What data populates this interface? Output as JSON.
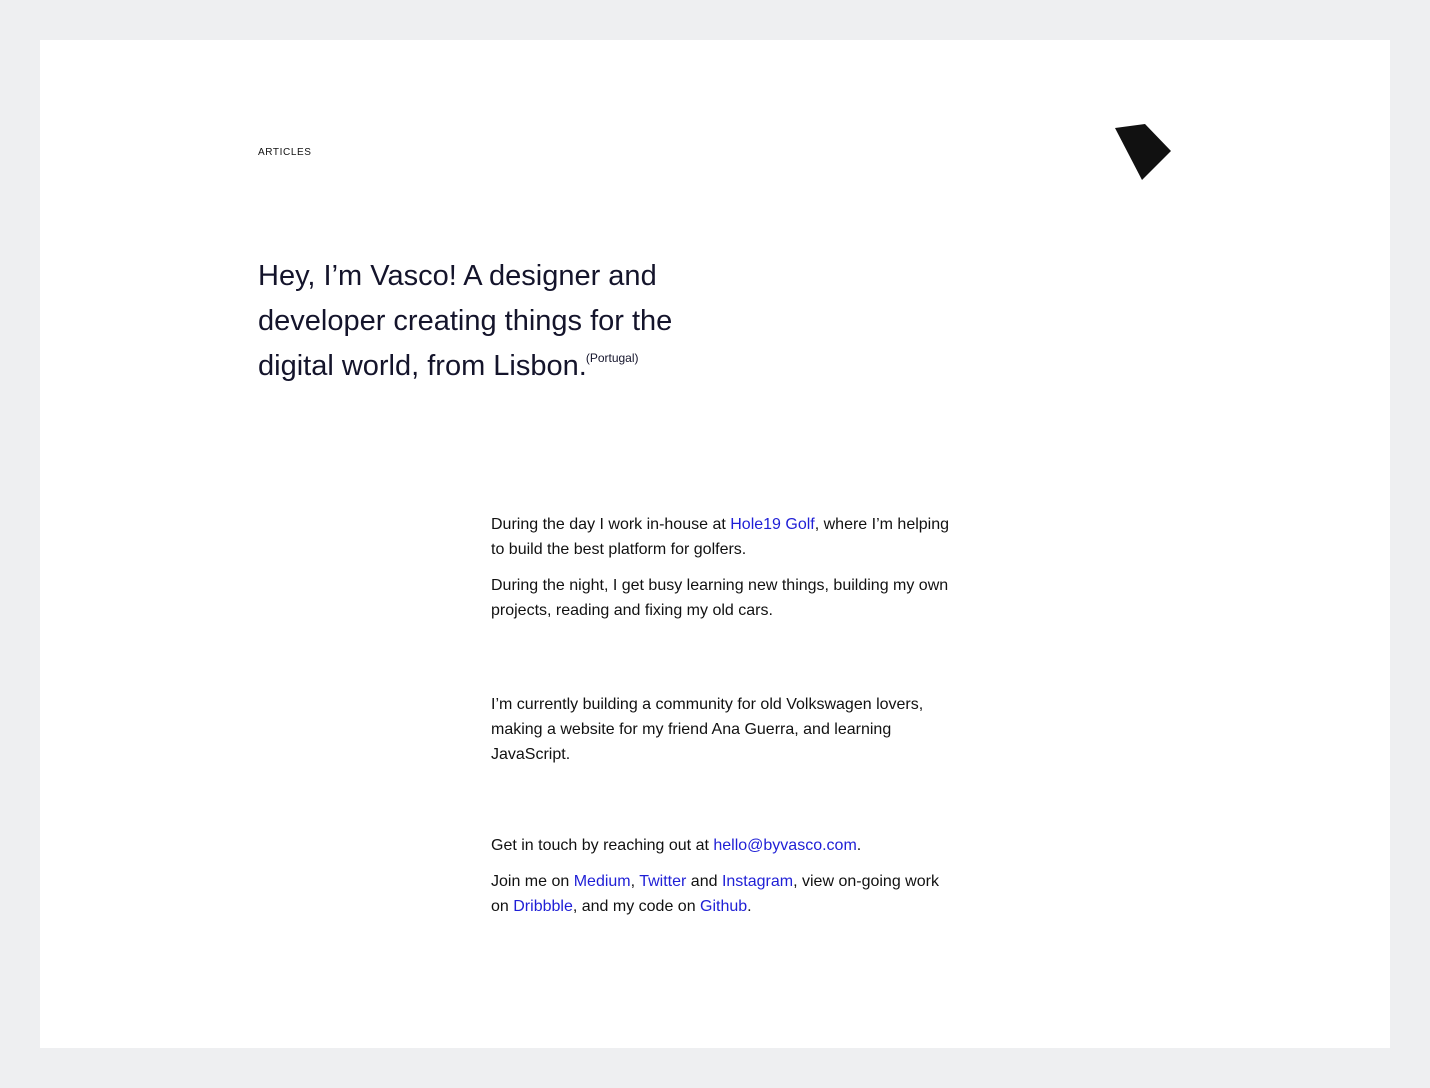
{
  "nav": {
    "articles_label": "ARTICLES"
  },
  "logo": {
    "icon": "arrow-cursor-logo",
    "color": "#111111"
  },
  "hero": {
    "text": "Hey, I’m Vasco! A designer and developer creating things for the digital world, from Lisbon.",
    "superscript": "(Portugal)"
  },
  "work": {
    "p1_before": "During the day I work in-house at ",
    "p1_link": "Hole19 Golf",
    "p1_after": ", where I’m helping to build the best platform for golfers.",
    "p2": "During the night, I get busy learning new things, building my own projects, reading and fixing my old cars."
  },
  "current": {
    "p1": "I’m currently building a community for old Volkswagen lovers, making a website for my friend Ana Guerra, and learning JavaScript."
  },
  "contact": {
    "p1_before": "Get in touch by reaching out at ",
    "email": "hello@byvasco.com",
    "p1_after": ".",
    "p2_before": "Join me on ",
    "medium": "Medium",
    "sep_comma": ", ",
    "twitter": "Twitter",
    "and": " and ",
    "instagram": "Instagram",
    "view": ", view on-going work on ",
    "dribbble": "Dribbble",
    "code": ", and my code on ",
    "github": "Github",
    "end": "."
  },
  "colors": {
    "page_bg": "#eeeff1",
    "card_bg": "#ffffff",
    "heading": "#14142b",
    "link": "#1f1fd6"
  }
}
